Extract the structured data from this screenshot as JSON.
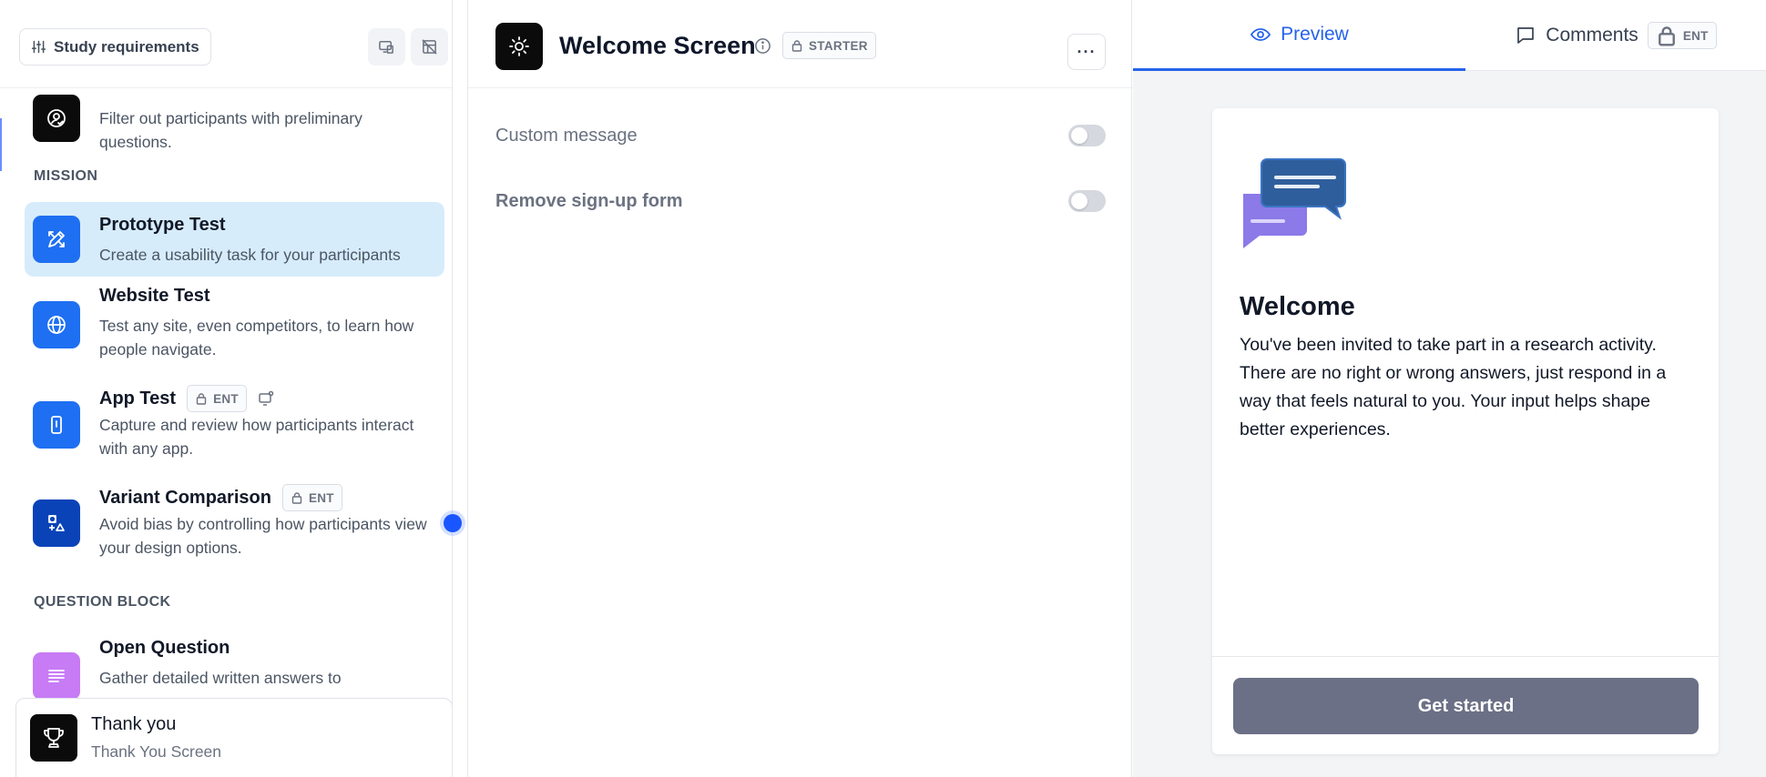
{
  "left": {
    "study_requirements_label": "Study requirements",
    "screener_desc": "Filter out participants with preliminary questions.",
    "mission_label": "MISSION",
    "question_block_label": "QUESTION BLOCK",
    "blocks": [
      {
        "title": "Prototype Test",
        "desc": "Create a usability task for your participants",
        "icon": "prototype-icon",
        "color": "#1e6ff2"
      },
      {
        "title": "Website Test",
        "desc": "Test any site, even competitors, to learn how people navigate.",
        "icon": "globe-icon",
        "color": "#1e6ff2"
      },
      {
        "title": "App Test",
        "badge": "ENT",
        "desc": "Capture and review how participants interact with any app.",
        "icon": "mobile-icon",
        "color": "#1e6ff2"
      },
      {
        "title": "Variant Comparison",
        "badge": "ENT",
        "desc": "Avoid bias by controlling how participants view your design options.",
        "icon": "variants-icon",
        "color": "#0a43b8"
      },
      {
        "title": "Open Question",
        "desc": "Gather detailed written answers to",
        "icon": "text-lines-icon",
        "color": "#c77bf5"
      }
    ],
    "thank_you": {
      "title": "Thank you",
      "subtitle": "Thank You Screen"
    }
  },
  "middle": {
    "title": "Welcome Screen",
    "badge": "STARTER",
    "more_label": "···",
    "settings": [
      {
        "label": "Custom message",
        "enabled": false
      },
      {
        "label": "Remove sign-up form",
        "enabled": false
      }
    ]
  },
  "right": {
    "tabs": {
      "preview": "Preview",
      "comments": "Comments",
      "comments_badge": "ENT"
    },
    "preview": {
      "heading": "Welcome",
      "body": "You've been invited to take part in a research activity. There are no right or wrong answers, just respond in a way that feels natural to you. Your input helps shape better experiences.",
      "button": "Get started"
    }
  },
  "colors": {
    "accent": "#2563eb",
    "active_block_bg": "#d6ecfb",
    "button_bg": "#6b7086"
  }
}
